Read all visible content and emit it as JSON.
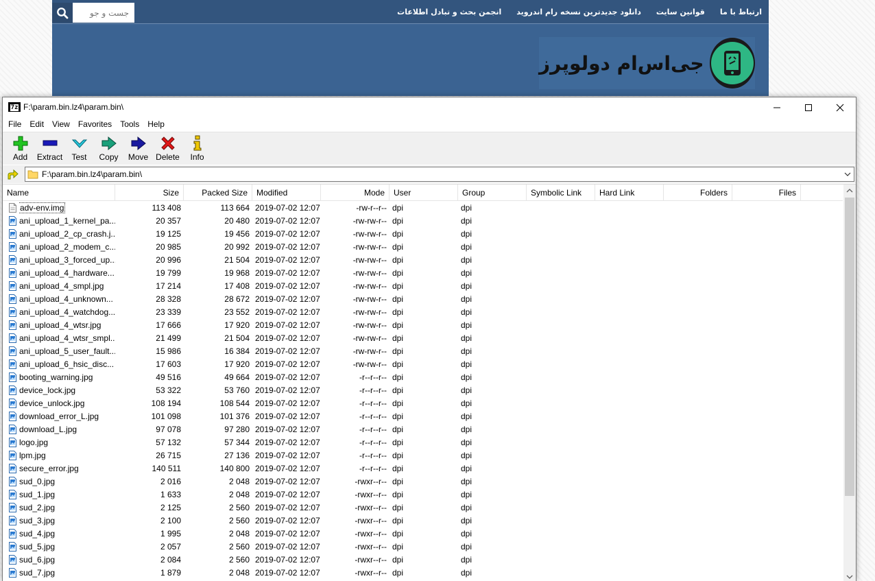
{
  "website": {
    "nav_links": [
      "انجمن بحث و تبادل اطلاعات",
      "دانلود جدیدترین نسخه رام اندروید",
      "قوانین سایت",
      "ارتباط با ما"
    ],
    "search_placeholder": "جست و جو",
    "logo_text": "جی‌اس‌ام دولوپرز"
  },
  "window": {
    "title": "F:\\param.bin.lz4\\param.bin\\",
    "app_icon": "7z",
    "menu": [
      "File",
      "Edit",
      "View",
      "Favorites",
      "Tools",
      "Help"
    ],
    "toolbar": [
      {
        "label": "Add",
        "icon": "plus-icon",
        "color": "#22b422"
      },
      {
        "label": "Extract",
        "icon": "minus-icon",
        "color": "#1a1aa8"
      },
      {
        "label": "Test",
        "icon": "check-down-icon",
        "color": "#18b0c8"
      },
      {
        "label": "Copy",
        "icon": "copy-arrow-icon",
        "color": "#158a6a"
      },
      {
        "label": "Move",
        "icon": "move-arrow-icon",
        "color": "#1a1a8a"
      },
      {
        "label": "Delete",
        "icon": "delete-x-icon",
        "color": "#d01010"
      },
      {
        "label": "Info",
        "icon": "info-icon",
        "color": "#d8b000"
      }
    ],
    "address": "F:\\param.bin.lz4\\param.bin\\",
    "columns": [
      "Name",
      "Size",
      "Packed Size",
      "Modified",
      "Mode",
      "User",
      "Group",
      "Symbolic Link",
      "Hard Link",
      "Folders",
      "Files"
    ],
    "files": [
      {
        "name": "adv-env.img",
        "size": "113 408",
        "packed": "113 664",
        "modified": "2019-07-02 12:07",
        "mode": "-rw-r--r--",
        "user": "dpi",
        "group": "dpi",
        "type": "file"
      },
      {
        "name": "ani_upload_1_kernel_pa...",
        "size": "20 357",
        "packed": "20 480",
        "modified": "2019-07-02 12:07",
        "mode": "-rw-rw-r--",
        "user": "dpi",
        "group": "dpi",
        "type": "image"
      },
      {
        "name": "ani_upload_2_cp_crash.j...",
        "size": "19 125",
        "packed": "19 456",
        "modified": "2019-07-02 12:07",
        "mode": "-rw-rw-r--",
        "user": "dpi",
        "group": "dpi",
        "type": "image"
      },
      {
        "name": "ani_upload_2_modem_c...",
        "size": "20 985",
        "packed": "20 992",
        "modified": "2019-07-02 12:07",
        "mode": "-rw-rw-r--",
        "user": "dpi",
        "group": "dpi",
        "type": "image"
      },
      {
        "name": "ani_upload_3_forced_up...",
        "size": "20 996",
        "packed": "21 504",
        "modified": "2019-07-02 12:07",
        "mode": "-rw-rw-r--",
        "user": "dpi",
        "group": "dpi",
        "type": "image"
      },
      {
        "name": "ani_upload_4_hardware...",
        "size": "19 799",
        "packed": "19 968",
        "modified": "2019-07-02 12:07",
        "mode": "-rw-rw-r--",
        "user": "dpi",
        "group": "dpi",
        "type": "image"
      },
      {
        "name": "ani_upload_4_smpl.jpg",
        "size": "17 214",
        "packed": "17 408",
        "modified": "2019-07-02 12:07",
        "mode": "-rw-rw-r--",
        "user": "dpi",
        "group": "dpi",
        "type": "image"
      },
      {
        "name": "ani_upload_4_unknown...",
        "size": "28 328",
        "packed": "28 672",
        "modified": "2019-07-02 12:07",
        "mode": "-rw-rw-r--",
        "user": "dpi",
        "group": "dpi",
        "type": "image"
      },
      {
        "name": "ani_upload_4_watchdog...",
        "size": "23 339",
        "packed": "23 552",
        "modified": "2019-07-02 12:07",
        "mode": "-rw-rw-r--",
        "user": "dpi",
        "group": "dpi",
        "type": "image"
      },
      {
        "name": "ani_upload_4_wtsr.jpg",
        "size": "17 666",
        "packed": "17 920",
        "modified": "2019-07-02 12:07",
        "mode": "-rw-rw-r--",
        "user": "dpi",
        "group": "dpi",
        "type": "image"
      },
      {
        "name": "ani_upload_4_wtsr_smpl...",
        "size": "21 499",
        "packed": "21 504",
        "modified": "2019-07-02 12:07",
        "mode": "-rw-rw-r--",
        "user": "dpi",
        "group": "dpi",
        "type": "image"
      },
      {
        "name": "ani_upload_5_user_fault...",
        "size": "15 986",
        "packed": "16 384",
        "modified": "2019-07-02 12:07",
        "mode": "-rw-rw-r--",
        "user": "dpi",
        "group": "dpi",
        "type": "image"
      },
      {
        "name": "ani_upload_6_hsic_disc...",
        "size": "17 603",
        "packed": "17 920",
        "modified": "2019-07-02 12:07",
        "mode": "-rw-rw-r--",
        "user": "dpi",
        "group": "dpi",
        "type": "image"
      },
      {
        "name": "booting_warning.jpg",
        "size": "49 516",
        "packed": "49 664",
        "modified": "2019-07-02 12:07",
        "mode": "-r--r--r--",
        "user": "dpi",
        "group": "dpi",
        "type": "image"
      },
      {
        "name": "device_lock.jpg",
        "size": "53 322",
        "packed": "53 760",
        "modified": "2019-07-02 12:07",
        "mode": "-r--r--r--",
        "user": "dpi",
        "group": "dpi",
        "type": "image"
      },
      {
        "name": "device_unlock.jpg",
        "size": "108 194",
        "packed": "108 544",
        "modified": "2019-07-02 12:07",
        "mode": "-r--r--r--",
        "user": "dpi",
        "group": "dpi",
        "type": "image"
      },
      {
        "name": "download_error_L.jpg",
        "size": "101 098",
        "packed": "101 376",
        "modified": "2019-07-02 12:07",
        "mode": "-r--r--r--",
        "user": "dpi",
        "group": "dpi",
        "type": "image"
      },
      {
        "name": "download_L.jpg",
        "size": "97 078",
        "packed": "97 280",
        "modified": "2019-07-02 12:07",
        "mode": "-r--r--r--",
        "user": "dpi",
        "group": "dpi",
        "type": "image"
      },
      {
        "name": "logo.jpg",
        "size": "57 132",
        "packed": "57 344",
        "modified": "2019-07-02 12:07",
        "mode": "-r--r--r--",
        "user": "dpi",
        "group": "dpi",
        "type": "image"
      },
      {
        "name": "lpm.jpg",
        "size": "26 715",
        "packed": "27 136",
        "modified": "2019-07-02 12:07",
        "mode": "-r--r--r--",
        "user": "dpi",
        "group": "dpi",
        "type": "image"
      },
      {
        "name": "secure_error.jpg",
        "size": "140 511",
        "packed": "140 800",
        "modified": "2019-07-02 12:07",
        "mode": "-r--r--r--",
        "user": "dpi",
        "group": "dpi",
        "type": "image"
      },
      {
        "name": "sud_0.jpg",
        "size": "2 016",
        "packed": "2 048",
        "modified": "2019-07-02 12:07",
        "mode": "-rwxr--r--",
        "user": "dpi",
        "group": "dpi",
        "type": "image"
      },
      {
        "name": "sud_1.jpg",
        "size": "1 633",
        "packed": "2 048",
        "modified": "2019-07-02 12:07",
        "mode": "-rwxr--r--",
        "user": "dpi",
        "group": "dpi",
        "type": "image"
      },
      {
        "name": "sud_2.jpg",
        "size": "2 125",
        "packed": "2 560",
        "modified": "2019-07-02 12:07",
        "mode": "-rwxr--r--",
        "user": "dpi",
        "group": "dpi",
        "type": "image"
      },
      {
        "name": "sud_3.jpg",
        "size": "2 100",
        "packed": "2 560",
        "modified": "2019-07-02 12:07",
        "mode": "-rwxr--r--",
        "user": "dpi",
        "group": "dpi",
        "type": "image"
      },
      {
        "name": "sud_4.jpg",
        "size": "1 995",
        "packed": "2 048",
        "modified": "2019-07-02 12:07",
        "mode": "-rwxr--r--",
        "user": "dpi",
        "group": "dpi",
        "type": "image"
      },
      {
        "name": "sud_5.jpg",
        "size": "2 057",
        "packed": "2 560",
        "modified": "2019-07-02 12:07",
        "mode": "-rwxr--r--",
        "user": "dpi",
        "group": "dpi",
        "type": "image"
      },
      {
        "name": "sud_6.jpg",
        "size": "2 084",
        "packed": "2 560",
        "modified": "2019-07-02 12:07",
        "mode": "-rwxr--r--",
        "user": "dpi",
        "group": "dpi",
        "type": "image"
      },
      {
        "name": "sud_7.jpg",
        "size": "1 879",
        "packed": "2 048",
        "modified": "2019-07-02 12:07",
        "mode": "-rwxr--r--",
        "user": "dpi",
        "group": "dpi",
        "type": "image"
      }
    ]
  }
}
